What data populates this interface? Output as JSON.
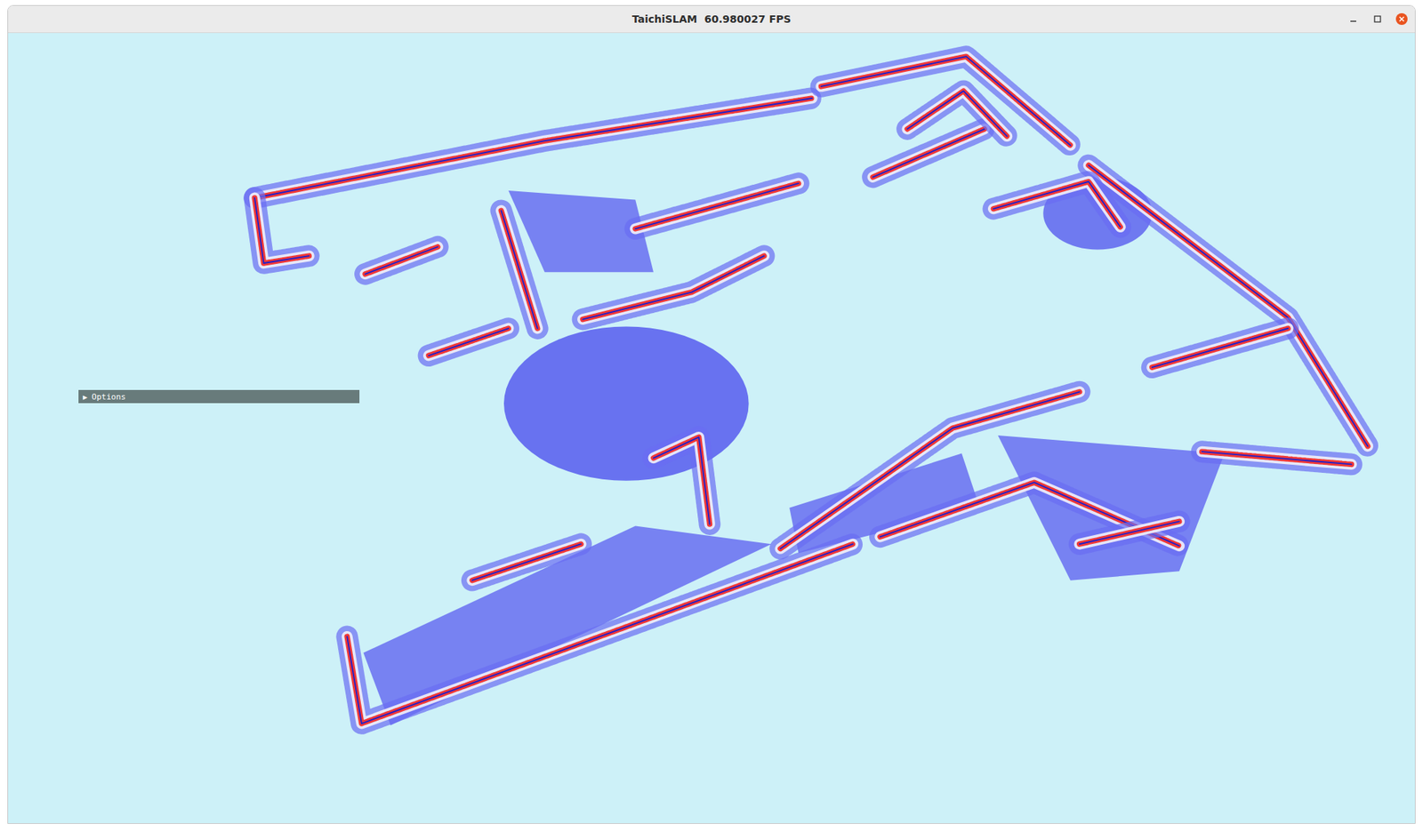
{
  "window": {
    "title": "TaichiSLAM  60.980027 FPS"
  },
  "options_panel": {
    "arrow": "▶",
    "label": "Options",
    "expanded": false
  }
}
